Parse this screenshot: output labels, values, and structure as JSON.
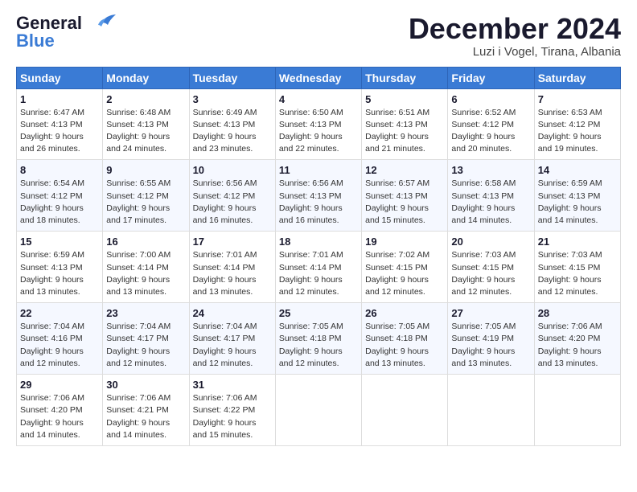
{
  "logo": {
    "line1": "General",
    "line2": "Blue"
  },
  "header": {
    "title": "December 2024",
    "location": "Luzi i Vogel, Tirana, Albania"
  },
  "weekdays": [
    "Sunday",
    "Monday",
    "Tuesday",
    "Wednesday",
    "Thursday",
    "Friday",
    "Saturday"
  ],
  "weeks": [
    [
      {
        "day": "1",
        "sunrise": "6:47 AM",
        "sunset": "4:13 PM",
        "daylight": "9 hours and 26 minutes."
      },
      {
        "day": "2",
        "sunrise": "6:48 AM",
        "sunset": "4:13 PM",
        "daylight": "9 hours and 24 minutes."
      },
      {
        "day": "3",
        "sunrise": "6:49 AM",
        "sunset": "4:13 PM",
        "daylight": "9 hours and 23 minutes."
      },
      {
        "day": "4",
        "sunrise": "6:50 AM",
        "sunset": "4:13 PM",
        "daylight": "9 hours and 22 minutes."
      },
      {
        "day": "5",
        "sunrise": "6:51 AM",
        "sunset": "4:13 PM",
        "daylight": "9 hours and 21 minutes."
      },
      {
        "day": "6",
        "sunrise": "6:52 AM",
        "sunset": "4:12 PM",
        "daylight": "9 hours and 20 minutes."
      },
      {
        "day": "7",
        "sunrise": "6:53 AM",
        "sunset": "4:12 PM",
        "daylight": "9 hours and 19 minutes."
      }
    ],
    [
      {
        "day": "8",
        "sunrise": "6:54 AM",
        "sunset": "4:12 PM",
        "daylight": "9 hours and 18 minutes."
      },
      {
        "day": "9",
        "sunrise": "6:55 AM",
        "sunset": "4:12 PM",
        "daylight": "9 hours and 17 minutes."
      },
      {
        "day": "10",
        "sunrise": "6:56 AM",
        "sunset": "4:12 PM",
        "daylight": "9 hours and 16 minutes."
      },
      {
        "day": "11",
        "sunrise": "6:56 AM",
        "sunset": "4:13 PM",
        "daylight": "9 hours and 16 minutes."
      },
      {
        "day": "12",
        "sunrise": "6:57 AM",
        "sunset": "4:13 PM",
        "daylight": "9 hours and 15 minutes."
      },
      {
        "day": "13",
        "sunrise": "6:58 AM",
        "sunset": "4:13 PM",
        "daylight": "9 hours and 14 minutes."
      },
      {
        "day": "14",
        "sunrise": "6:59 AM",
        "sunset": "4:13 PM",
        "daylight": "9 hours and 14 minutes."
      }
    ],
    [
      {
        "day": "15",
        "sunrise": "6:59 AM",
        "sunset": "4:13 PM",
        "daylight": "9 hours and 13 minutes."
      },
      {
        "day": "16",
        "sunrise": "7:00 AM",
        "sunset": "4:14 PM",
        "daylight": "9 hours and 13 minutes."
      },
      {
        "day": "17",
        "sunrise": "7:01 AM",
        "sunset": "4:14 PM",
        "daylight": "9 hours and 13 minutes."
      },
      {
        "day": "18",
        "sunrise": "7:01 AM",
        "sunset": "4:14 PM",
        "daylight": "9 hours and 12 minutes."
      },
      {
        "day": "19",
        "sunrise": "7:02 AM",
        "sunset": "4:15 PM",
        "daylight": "9 hours and 12 minutes."
      },
      {
        "day": "20",
        "sunrise": "7:03 AM",
        "sunset": "4:15 PM",
        "daylight": "9 hours and 12 minutes."
      },
      {
        "day": "21",
        "sunrise": "7:03 AM",
        "sunset": "4:15 PM",
        "daylight": "9 hours and 12 minutes."
      }
    ],
    [
      {
        "day": "22",
        "sunrise": "7:04 AM",
        "sunset": "4:16 PM",
        "daylight": "9 hours and 12 minutes."
      },
      {
        "day": "23",
        "sunrise": "7:04 AM",
        "sunset": "4:17 PM",
        "daylight": "9 hours and 12 minutes."
      },
      {
        "day": "24",
        "sunrise": "7:04 AM",
        "sunset": "4:17 PM",
        "daylight": "9 hours and 12 minutes."
      },
      {
        "day": "25",
        "sunrise": "7:05 AM",
        "sunset": "4:18 PM",
        "daylight": "9 hours and 12 minutes."
      },
      {
        "day": "26",
        "sunrise": "7:05 AM",
        "sunset": "4:18 PM",
        "daylight": "9 hours and 13 minutes."
      },
      {
        "day": "27",
        "sunrise": "7:05 AM",
        "sunset": "4:19 PM",
        "daylight": "9 hours and 13 minutes."
      },
      {
        "day": "28",
        "sunrise": "7:06 AM",
        "sunset": "4:20 PM",
        "daylight": "9 hours and 13 minutes."
      }
    ],
    [
      {
        "day": "29",
        "sunrise": "7:06 AM",
        "sunset": "4:20 PM",
        "daylight": "9 hours and 14 minutes."
      },
      {
        "day": "30",
        "sunrise": "7:06 AM",
        "sunset": "4:21 PM",
        "daylight": "9 hours and 14 minutes."
      },
      {
        "day": "31",
        "sunrise": "7:06 AM",
        "sunset": "4:22 PM",
        "daylight": "9 hours and 15 minutes."
      },
      null,
      null,
      null,
      null
    ]
  ]
}
